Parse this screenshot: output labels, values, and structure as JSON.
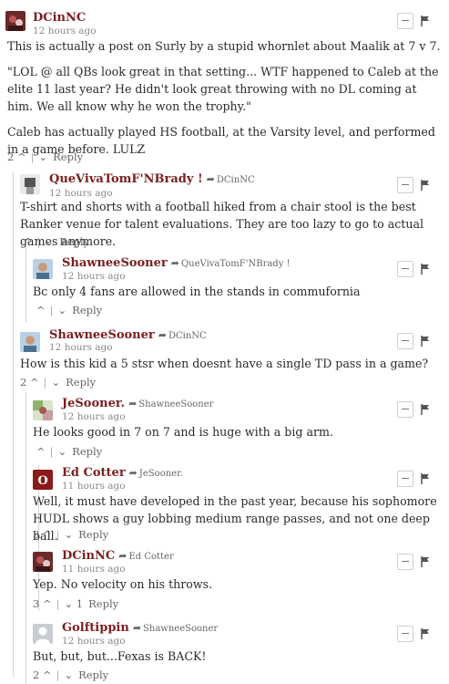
{
  "comments": [
    {
      "author": "DCinNC",
      "reply_to": "",
      "time": "12 hours ago",
      "paragraphs": [
        "This is actually a post on Surly by a stupid whornlet about Maalik at 7 v 7.",
        "\"LOL @ all QBs look great in that setting... WTF happened to Caleb at the elite 11 last year? He didn't look great throwing with no DL coming at him. We all know why he won the trophy.\"",
        "Caleb has actually played HS football, at the Varsity level, and performed in a game before. LULZ"
      ],
      "upvotes": "2",
      "downvotes": "",
      "reply_label": "Reply"
    },
    {
      "author": "QueVivaTomF'NBrady !",
      "reply_to": "DCinNC",
      "time": "12 hours ago",
      "paragraphs": [
        "T-shirt and shorts with a football hiked from a chair stool is the best Ranker venue for talent evaluations. They are too lazy to go to actual games anymore."
      ],
      "upvotes": "",
      "downvotes": "",
      "reply_label": "Reply"
    },
    {
      "author": "ShawneeSooner",
      "reply_to": "QueVivaTomF'NBrady !",
      "time": "12 hours ago",
      "paragraphs": [
        "Bc only 4 fans are allowed in the stands in commufornia"
      ],
      "upvotes": "",
      "downvotes": "",
      "reply_label": "Reply"
    },
    {
      "author": "ShawneeSooner",
      "reply_to": "DCinNC",
      "time": "12 hours ago",
      "paragraphs": [
        "How is this kid a 5 stsr when doesnt have a single TD pass in a game?"
      ],
      "upvotes": "2",
      "downvotes": "",
      "reply_label": "Reply"
    },
    {
      "author": "JeSooner.",
      "reply_to": "ShawneeSooner",
      "time": "12 hours ago",
      "paragraphs": [
        "He looks good in 7 on 7 and is huge with a big arm."
      ],
      "upvotes": "",
      "downvotes": "",
      "reply_label": "Reply"
    },
    {
      "author": "Ed Cotter",
      "reply_to": "JeSooner.",
      "time": "11 hours ago",
      "paragraphs": [
        "Well, it must have developed in the past year, because his sophomore HUDL shows a guy lobbing medium range passes, and not one deep ball."
      ],
      "upvotes": "3",
      "downvotes": "",
      "reply_label": "Reply"
    },
    {
      "author": "DCinNC",
      "reply_to": "Ed Cotter",
      "time": "11 hours ago",
      "paragraphs": [
        "Yep. No velocity on his throws."
      ],
      "upvotes": "3",
      "downvotes": "1",
      "reply_label": "Reply"
    },
    {
      "author": "Golftippin",
      "reply_to": "ShawneeSooner",
      "time": "12 hours ago",
      "paragraphs": [
        "But, but, but...Fexas is BACK!"
      ],
      "upvotes": "2",
      "downvotes": "",
      "reply_label": "Reply"
    }
  ],
  "colors": {
    "author": "#7a1f1f",
    "meta": "#8a8a8a",
    "text": "#2a2a2a",
    "thread_line": "#d5d5d5"
  },
  "icons": {
    "upvote": "chevron-up-icon",
    "downvote": "chevron-down-icon",
    "reply_arrow": "reply-arrow-icon",
    "collapse": "collapse-icon",
    "flag": "flag-icon"
  }
}
